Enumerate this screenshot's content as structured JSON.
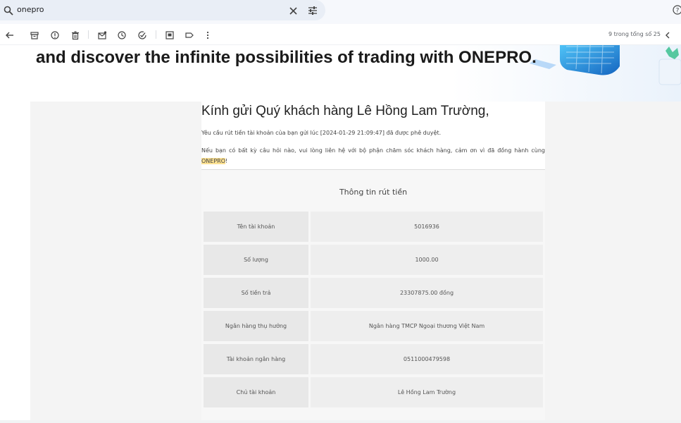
{
  "search": {
    "query": "onepro",
    "search_icon": "search-icon",
    "clear_icon": "close-icon",
    "filter_icon": "tune-icon"
  },
  "header": {
    "help_icon": "help-icon"
  },
  "toolbar": {
    "icons": [
      "back-arrow-icon",
      "archive-icon",
      "report-spam-icon",
      "delete-icon",
      "mark-unread-icon",
      "snooze-icon",
      "add-task-icon",
      "move-to-icon",
      "label-icon",
      "more-vert-icon",
      "prev-icon"
    ],
    "count_label": "9 trong tổng số 25"
  },
  "email": {
    "hero_text": "and discover the infinite possibilities of trading with ONEPRO.",
    "greeting": "Kính gửi Quý khách hàng Lê Hồng Lam Trường,",
    "paragraph1": "Yêu cầu rút tiền tài khoản của bạn gửi lúc [2024-01-29 21:09:47] đã được phê duyệt.",
    "paragraph2_before": "Nếu bạn có bất kỳ câu hỏi nào, vui lòng liên hệ với bộ phận chăm sóc khách hàng, cảm ơn vì đã đồng hành cùng ",
    "paragraph2_highlight": "ONEPRO",
    "paragraph2_after": "!",
    "table_title": "Thông tin rút tiền",
    "rows": [
      {
        "label": "Tên tài khoản",
        "value": "5016936"
      },
      {
        "label": "Số lượng",
        "value": "1000.00"
      },
      {
        "label": "Số tiền trả",
        "value": "23307875.00 đồng"
      },
      {
        "label": "Ngân hàng thụ hưởng",
        "value": "Ngân hàng TMCP Ngoại thương Việt Nam"
      },
      {
        "label": "Tài khoản ngân hàng",
        "value": "0511000479598"
      },
      {
        "label": "Chủ tài khoản",
        "value": "Lê Hồng Lam Trường"
      }
    ]
  },
  "colors": {
    "highlight": "#fde293",
    "accent_blue": "#1e88e5"
  }
}
